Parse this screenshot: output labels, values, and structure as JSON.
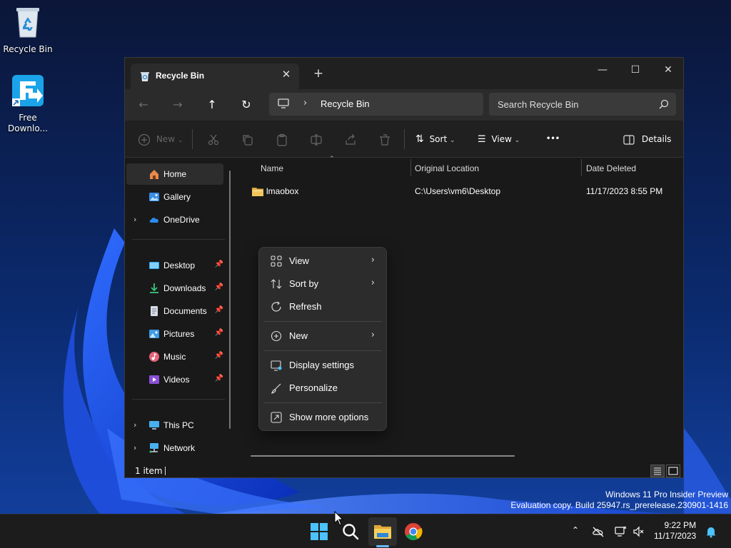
{
  "desktop": {
    "icons": [
      {
        "label": "Recycle Bin"
      },
      {
        "label": "Free Downlo..."
      }
    ],
    "watermark": {
      "line1": "Windows 11 Pro Insider Preview",
      "line2": "Evaluation copy. Build 25947.rs_prerelease.230901-1416"
    }
  },
  "window": {
    "tab_title": "Recycle Bin",
    "new_tab_glyph": "+",
    "controls": {
      "minimize": "—",
      "maximize": "☐",
      "close": "✕"
    },
    "breadcrumb": [
      "Recycle Bin"
    ],
    "search": {
      "placeholder": "Search Recycle Bin"
    },
    "toolbar": {
      "new_label": "New",
      "sort_label": "Sort",
      "view_label": "View",
      "more_label": "•••",
      "details_label": "Details"
    },
    "sidebar": {
      "items": [
        {
          "label": "Home",
          "icon": "home-icon"
        },
        {
          "label": "Gallery",
          "icon": "gallery-icon"
        },
        {
          "label": "OneDrive",
          "icon": "cloud-icon"
        },
        {
          "label": "Desktop",
          "icon": "desktop-icon"
        },
        {
          "label": "Downloads",
          "icon": "download-icon"
        },
        {
          "label": "Documents",
          "icon": "document-icon"
        },
        {
          "label": "Pictures",
          "icon": "picture-icon"
        },
        {
          "label": "Music",
          "icon": "music-icon"
        },
        {
          "label": "Videos",
          "icon": "video-icon"
        },
        {
          "label": "This PC",
          "icon": "pc-icon"
        },
        {
          "label": "Network",
          "icon": "network-icon"
        }
      ]
    },
    "columns": [
      "Name",
      "Original Location",
      "Date Deleted"
    ],
    "files": [
      {
        "name": "lmaobox",
        "location": "C:\\Users\\vm6\\Desktop",
        "date": "11/17/2023 8:55 PM"
      }
    ],
    "status": {
      "count": "1 item"
    }
  },
  "context_menu": {
    "items": [
      {
        "label": "View"
      },
      {
        "label": "Sort by"
      },
      {
        "label": "Refresh"
      },
      {
        "label": "New"
      },
      {
        "label": "Display settings"
      },
      {
        "label": "Personalize"
      },
      {
        "label": "Show more options"
      }
    ]
  },
  "taskbar": {
    "time": "9:22 PM",
    "date": "11/17/2023"
  },
  "colors": {
    "accent": "#4cc2ff",
    "folder": "#f2c55c",
    "window_bg": "#191919"
  }
}
